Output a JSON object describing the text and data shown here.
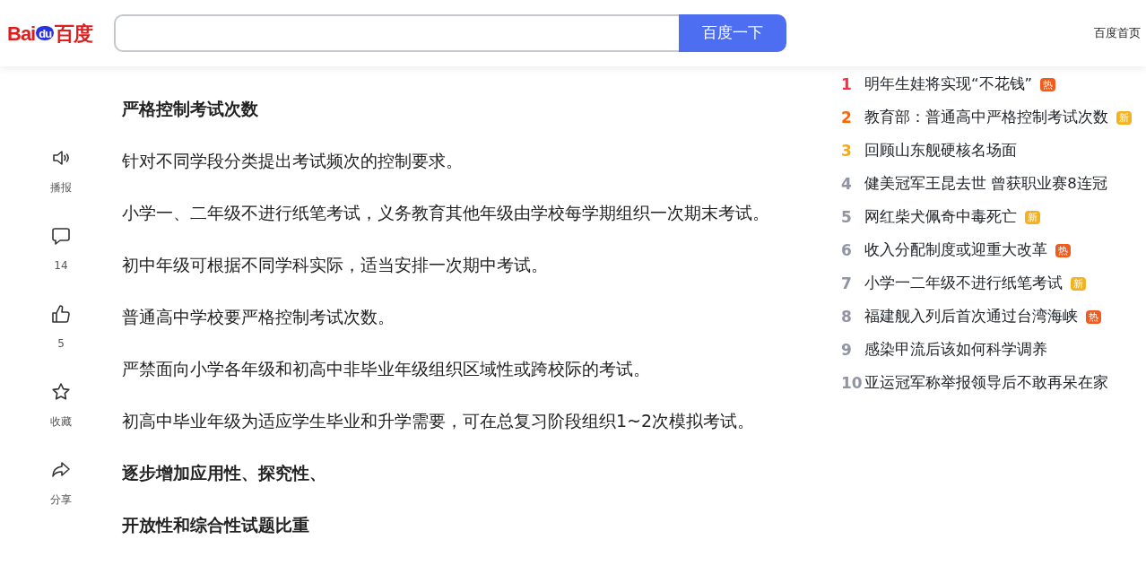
{
  "header": {
    "logo": {
      "latin": "Bai",
      "paw": "du",
      "chinese": "百度"
    },
    "search": {
      "button": "百度一下"
    },
    "home_link": "百度首页"
  },
  "side_actions": [
    {
      "kind": "speaker",
      "label": "播报"
    },
    {
      "kind": "comment",
      "label": "14"
    },
    {
      "kind": "like",
      "label": "5"
    },
    {
      "kind": "star",
      "label": "收藏"
    },
    {
      "kind": "share",
      "label": "分享"
    }
  ],
  "article": [
    {
      "kind": "heading",
      "text": "严格控制考试次数"
    },
    {
      "kind": "paragraph",
      "text": "针对不同学段分类提出考试频次的控制要求。"
    },
    {
      "kind": "paragraph",
      "text": "小学一、二年级不进行纸笔考试，义务教育其他年级由学校每学期组织一次期末考试。"
    },
    {
      "kind": "paragraph",
      "text": "初中年级可根据不同学科实际，适当安排一次期中考试。"
    },
    {
      "kind": "paragraph",
      "text": "普通高中学校要严格控制考试次数。"
    },
    {
      "kind": "paragraph",
      "text": "严禁面向小学各年级和初高中非毕业年级组织区域性或跨校际的考试。"
    },
    {
      "kind": "paragraph",
      "text": "初高中毕业年级为适应学生毕业和升学需要，可在总复习阶段组织1~2次模拟考试。"
    },
    {
      "kind": "heading",
      "text": "逐步增加应用性、探究性、"
    },
    {
      "kind": "heading",
      "text": "开放性和综合性试题比重"
    }
  ],
  "hot_list": [
    {
      "rank": "1",
      "title": "明年生娃将实现“不花钱”",
      "badge": {
        "text": "热",
        "kind": "hot"
      }
    },
    {
      "rank": "2",
      "title": "教育部：普通高中严格控制考试次数",
      "badge": {
        "text": "新",
        "kind": "new"
      }
    },
    {
      "rank": "3",
      "title": "回顾山东舰硬核名场面"
    },
    {
      "rank": "4",
      "title": "健美冠军王昆去世 曾获职业赛8连冠"
    },
    {
      "rank": "5",
      "title": "网红柴犬佩奇中毒死亡",
      "badge": {
        "text": "新",
        "kind": "new"
      }
    },
    {
      "rank": "6",
      "title": "收入分配制度或迎重大改革",
      "badge": {
        "text": "热",
        "kind": "hot"
      }
    },
    {
      "rank": "7",
      "title": "小学一二年级不进行纸笔考试",
      "badge": {
        "text": "新",
        "kind": "new"
      }
    },
    {
      "rank": "8",
      "title": "福建舰入列后首次通过台湾海峡",
      "badge": {
        "text": "热",
        "kind": "hot"
      }
    },
    {
      "rank": "9",
      "title": "感染甲流后该如何科学调养"
    },
    {
      "rank": "10",
      "title": "亚运冠军称举报领导后不敢再呆在家"
    }
  ]
}
